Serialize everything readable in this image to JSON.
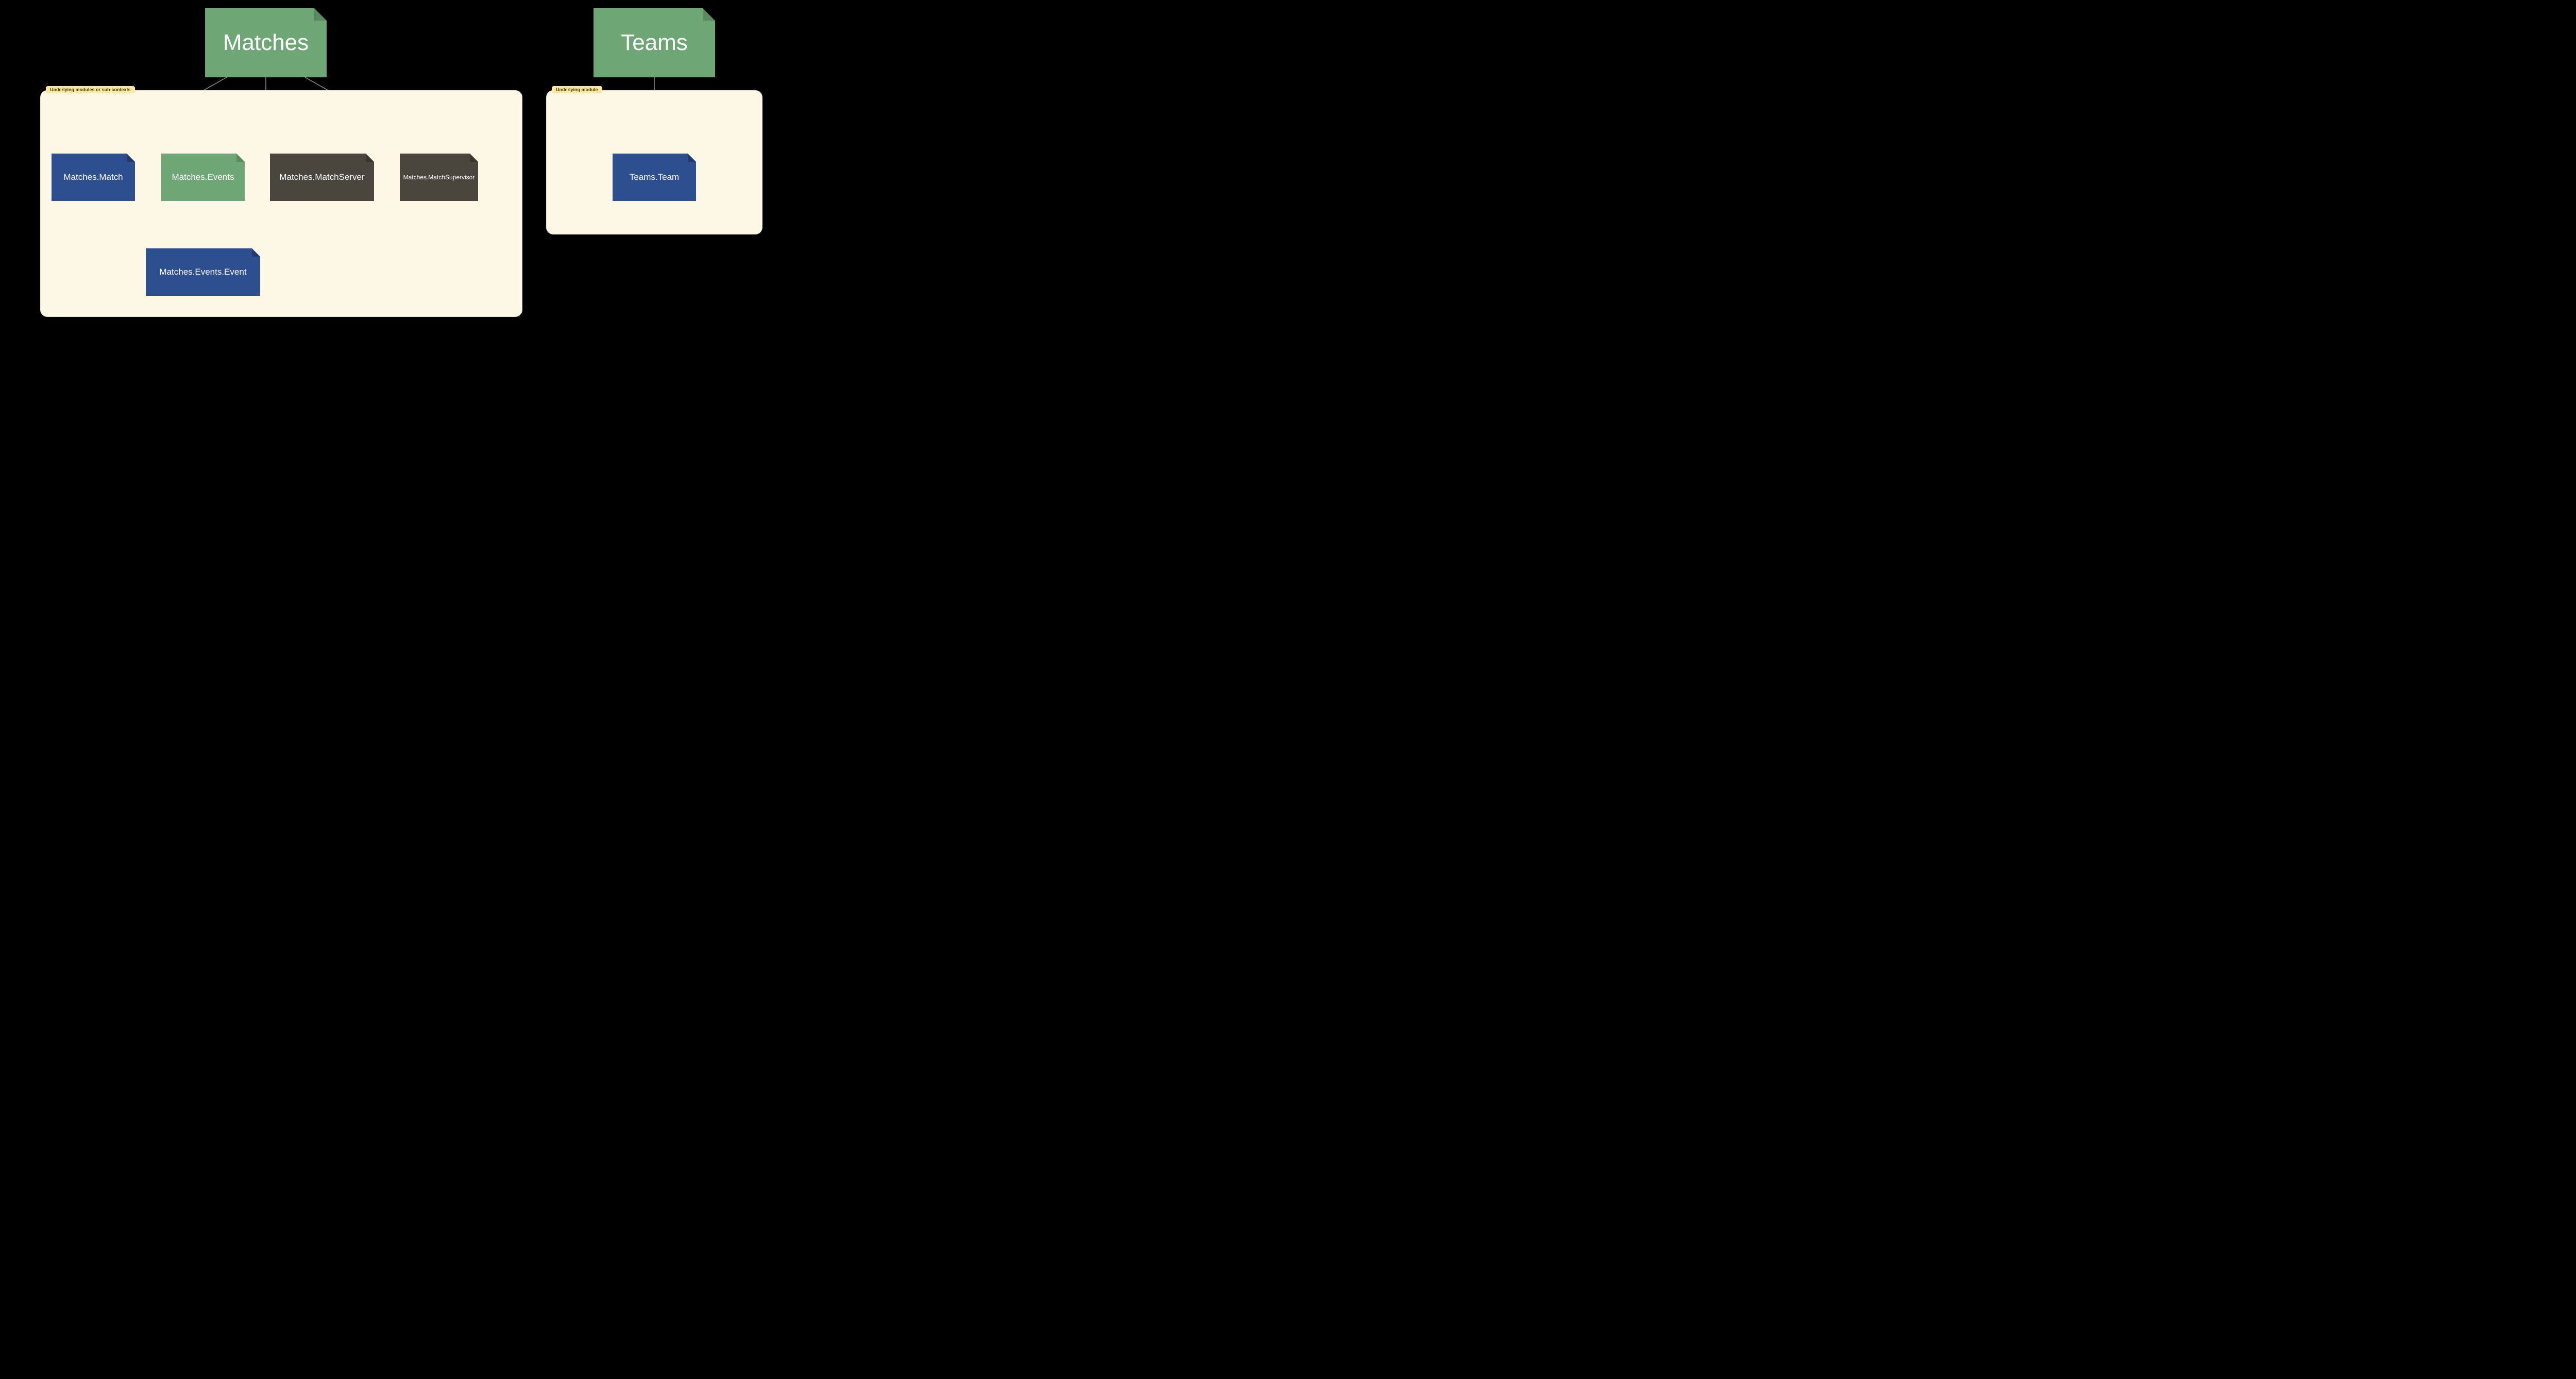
{
  "colors": {
    "green": "#6ea775",
    "blue": "#2d4e8f",
    "charcoal": "#4a463d",
    "group_bg": "#fcf8e5",
    "group_label_bg": "#fbe7a3"
  },
  "groups": {
    "matches": {
      "label": "Underlying modules or sub-contexts"
    },
    "teams": {
      "label": "Underlying module"
    }
  },
  "nodes": {
    "matches_root": {
      "label": "Matches"
    },
    "matches_match": {
      "label": "Matches.Match"
    },
    "matches_events": {
      "label": "Matches.Events"
    },
    "matches_matchserver": {
      "label": "Matches.MatchServer"
    },
    "matches_supervisor": {
      "label": "Matches.MatchSupervisor"
    },
    "matches_events_event": {
      "label": "Matches.Events.Event"
    },
    "teams_root": {
      "label": "Teams"
    },
    "teams_team": {
      "label": "Teams.Team"
    }
  },
  "edges": [
    {
      "from": "matches_root",
      "to": "matches_match"
    },
    {
      "from": "matches_root",
      "to": "matches_events"
    },
    {
      "from": "matches_root",
      "to": "matches_matchserver"
    },
    {
      "from": "matches_root",
      "to": "matches_supervisor"
    },
    {
      "from": "matches_events",
      "to": "matches_events_event"
    },
    {
      "from": "teams_root",
      "to": "teams_team"
    }
  ]
}
